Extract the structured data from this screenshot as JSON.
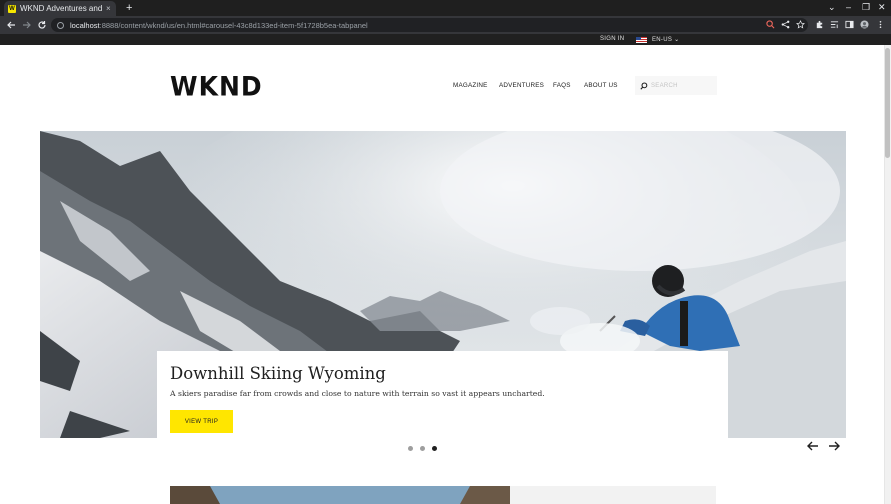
{
  "browser": {
    "tab_title": "WKND Adventures and Tr",
    "tab_favicon": "W",
    "tab_close": "×",
    "new_tab": "+",
    "url_host": "localhost",
    "url_path": ":8888/content/wknd/us/en.html#carousel-43c8d133ed-item-5f1728b5ea-tabpanel",
    "window_controls": [
      "⌄",
      "–",
      "❐",
      "✕"
    ]
  },
  "topbar": {
    "sign_in": "SIGN IN",
    "locale": "EN-US",
    "locale_chevron": "⌄"
  },
  "header": {
    "logo": "WKND",
    "nav": [
      "MAGAZINE",
      "ADVENTURES",
      "FAQS",
      "ABOUT US"
    ],
    "search_placeholder": "SEARCH"
  },
  "hero": {
    "title": "Downhill Skiing Wyoming",
    "description": "A skiers paradise far from crowds and close to nature with terrain so vast it appears uncharted.",
    "button_label": "VIEW TRIP",
    "indicators": [
      false,
      false,
      true
    ],
    "prev_arrow": "←",
    "next_arrow": "→"
  },
  "colors": {
    "accent": "#ffe600",
    "topbar_bg": "#202020",
    "text": "#202020"
  }
}
